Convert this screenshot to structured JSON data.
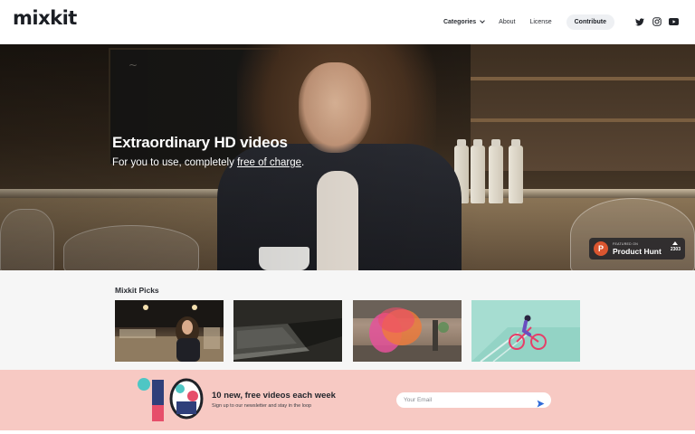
{
  "header": {
    "logo": "mixkit",
    "nav": {
      "categories": "Categories",
      "about": "About",
      "license": "License",
      "contribute": "Contribute"
    },
    "social_icons": [
      "twitter-icon",
      "instagram-icon",
      "youtube-icon"
    ]
  },
  "hero": {
    "title": "Extraordinary HD videos",
    "subtitle_prefix": "For you to use, completely ",
    "subtitle_link": "free of charge",
    "subtitle_suffix": "."
  },
  "product_hunt": {
    "featured": "FEATURED ON",
    "name": "Product Hunt",
    "logo_letter": "P",
    "votes": "2303"
  },
  "picks": {
    "title": "Mixkit Picks"
  },
  "newsletter": {
    "title": "10 new, free videos each week",
    "subtitle": "Sign up to our newsletter and stay in the loop",
    "email_placeholder": "Your Email"
  },
  "colors": {
    "newsletter_bg": "#f7c9c3",
    "product_hunt": "#da552f",
    "send_icon": "#2f6bd8"
  }
}
